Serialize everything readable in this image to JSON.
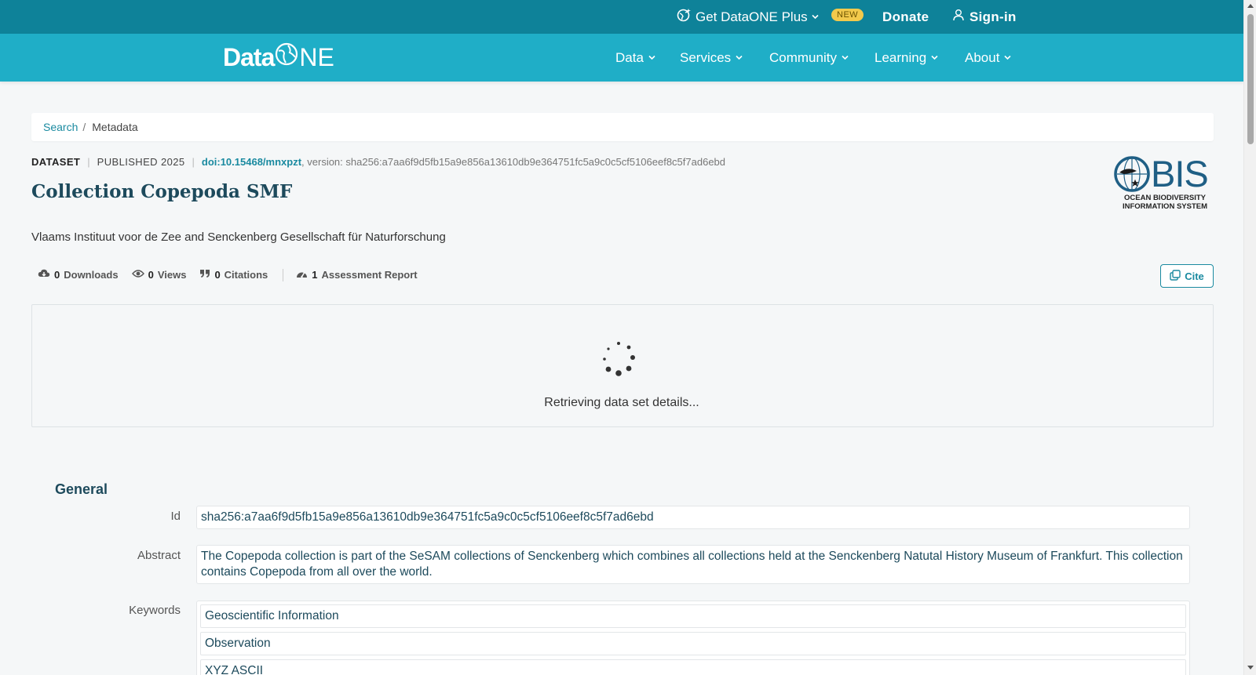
{
  "topbar": {
    "plus_label": "Get DataONE Plus",
    "new_badge": "NEW",
    "donate_label": "Donate",
    "signin_label": "Sign-in"
  },
  "brand": {
    "logo_data": "Data",
    "logo_one": "NE"
  },
  "nav": {
    "items": [
      "Data",
      "Services",
      "Community",
      "Learning",
      "About"
    ]
  },
  "breadcrumb": {
    "search": "Search",
    "separator": "/",
    "current": "Metadata"
  },
  "dataset": {
    "type": "DATASET",
    "published": "PUBLISHED 2025",
    "doi": "doi:10.15468/mnxpzt",
    "version_text": ", version: sha256:a7aa6f9d5fb15a9e856a13610db9e364751fc5a9c0c5cf5106eef8c5f7ad6ebd",
    "title": "Collection Copepoda SMF",
    "authors": "Vlaams Instituut voor de Zee and Senckenberg Gesellschaft für Naturforschung"
  },
  "obis": {
    "wordmark": "BIS",
    "subtitle_line1": "OCEAN BIODIVERSITY",
    "subtitle_line2": "INFORMATION SYSTEM"
  },
  "metrics": {
    "downloads_count": "0",
    "downloads_label": "Downloads",
    "views_count": "0",
    "views_label": "Views",
    "citations_count": "0",
    "citations_label": "Citations",
    "assessment_count": "1",
    "assessment_label": "Assessment Report"
  },
  "cite_label": "Cite",
  "loading_text": "Retrieving data set details...",
  "general": {
    "section_title": "General",
    "id_label": "Id",
    "id_value": "sha256:a7aa6f9d5fb15a9e856a13610db9e364751fc5a9c0c5cf5106eef8c5f7ad6ebd",
    "abstract_label": "Abstract",
    "abstract_value": "The Copepoda collection is part of the SeSAM collections of Senckenberg which combines all collections held at the Senckenberg Natutal History Museum of Frankfurt. This collection contains Copepoda from all over the world.",
    "keywords_label": "Keywords",
    "keywords": [
      "Geoscientific Information",
      "Observation",
      "XYZ ASCII"
    ]
  },
  "colors": {
    "topbar": "#0e8299",
    "nav": "#1faec7",
    "accent": "#1a8aa0",
    "badge": "#f2c94c",
    "heading": "#1d4a5c"
  }
}
